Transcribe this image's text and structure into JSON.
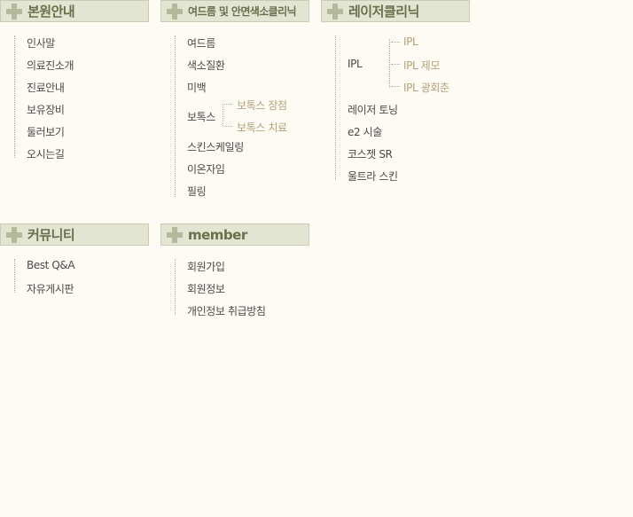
{
  "sections": {
    "intro": {
      "title": "본원안내",
      "items": [
        "인사말",
        "의료진소개",
        "진료안내",
        "보유장비",
        "둘러보기",
        "오시는길"
      ]
    },
    "acne": {
      "title": "여드름 및 안면색소클리닉",
      "items": [
        "여드름",
        "색소질환",
        "미백",
        "보톡스",
        "스킨스케일링",
        "이온자임",
        "필링"
      ],
      "botox_sub": [
        "보톡스 장점",
        "보톡스 치료"
      ]
    },
    "laser": {
      "title": "레이저클리닉",
      "items": [
        "IPL",
        "레이저 토닝",
        "e2 시술",
        "코스젯 SR",
        "울트라 스킨"
      ],
      "ipl_sub": [
        "IPL",
        "IPL 제모",
        "IPL 광회춘"
      ]
    },
    "community": {
      "title": "커뮤니티",
      "items": [
        "Best Q&A",
        "자유게시판"
      ]
    },
    "member": {
      "title": "member",
      "items": [
        "회원가입",
        "회원정보",
        "개인정보 취급방침"
      ]
    }
  }
}
